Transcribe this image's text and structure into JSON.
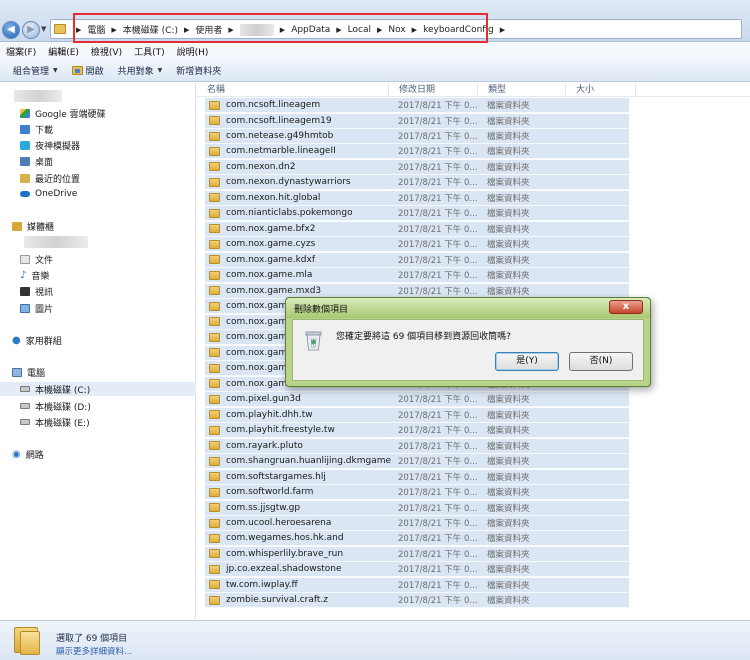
{
  "address_bar": {
    "crumbs": [
      "電腦",
      "本機磁碟 (C:)",
      "使用者",
      "AppData",
      "Local",
      "Nox",
      "keyboardConfig"
    ]
  },
  "menu": [
    "檔案(F)",
    "編輯(E)",
    "檢視(V)",
    "工具(T)",
    "說明(H)"
  ],
  "toolbar": {
    "organize": "組合管理",
    "open": "開啟",
    "share": "共用對象",
    "new_folder": "新增資料夾"
  },
  "sidebar": {
    "favorites": [
      "Google 雲端硬碟",
      "下載",
      "夜神模擬器",
      "桌面",
      "最近的位置",
      "OneDrive"
    ],
    "libraries_label": "媒體櫃",
    "libraries": [
      "文件",
      "音樂",
      "視訊",
      "圖片"
    ],
    "homegroup": "家用群組",
    "computer_label": "電腦",
    "drives": [
      "本機磁碟 (C:)",
      "本機磁碟 (D:)",
      "本機磁碟 (E:)"
    ],
    "network": "網路"
  },
  "columns": {
    "name": "名稱",
    "date": "修改日期",
    "type": "類型",
    "size": "大小"
  },
  "row_date": "2017/8/21 下午 0...",
  "row_type": "檔案資料夾",
  "files": [
    "com.ncsoft.lineagem",
    "com.ncsoft.lineagem19",
    "com.netease.g49hmtob",
    "com.netmarble.lineageII",
    "com.nexon.dn2",
    "com.nexon.dynastywarriors",
    "com.nexon.hit.global",
    "com.nianticlabs.pokemongo",
    "com.nox.game.bfx2",
    "com.nox.game.cyzs",
    "com.nox.game.kdxf",
    "com.nox.game.mla",
    "com.nox.game.mxd3",
    "com.nox.game",
    "com.nox.game",
    "com.nox.game",
    "com.nox.game",
    "com.nox.game",
    "com.nox.game.zdr",
    "com.pixel.gun3d",
    "com.playhit.dhh.tw",
    "com.playhit.freestyle.tw",
    "com.rayark.pluto",
    "com.shangruan.huanlijing.dkmgame",
    "com.softstargames.hlj",
    "com.softworld.farm",
    "com.ss.jjsgtw.gp",
    "com.ucool.heroesarena",
    "com.wegames.hos.hk.and",
    "com.whisperlily.brave_run",
    "jp.co.exzeal.shadowstone",
    "tw.com.iwplay.ff",
    "zombie.survival.craft.z"
  ],
  "status": {
    "selected": "選取了 69 個項目",
    "more_link": "顯示更多詳細資料..."
  },
  "dialog": {
    "title": "刪除數個項目",
    "message": "您確定要將這 69 個項目移到資源回收筒嗎?",
    "yes": "是(Y)",
    "no": "否(N)",
    "close": "x"
  }
}
